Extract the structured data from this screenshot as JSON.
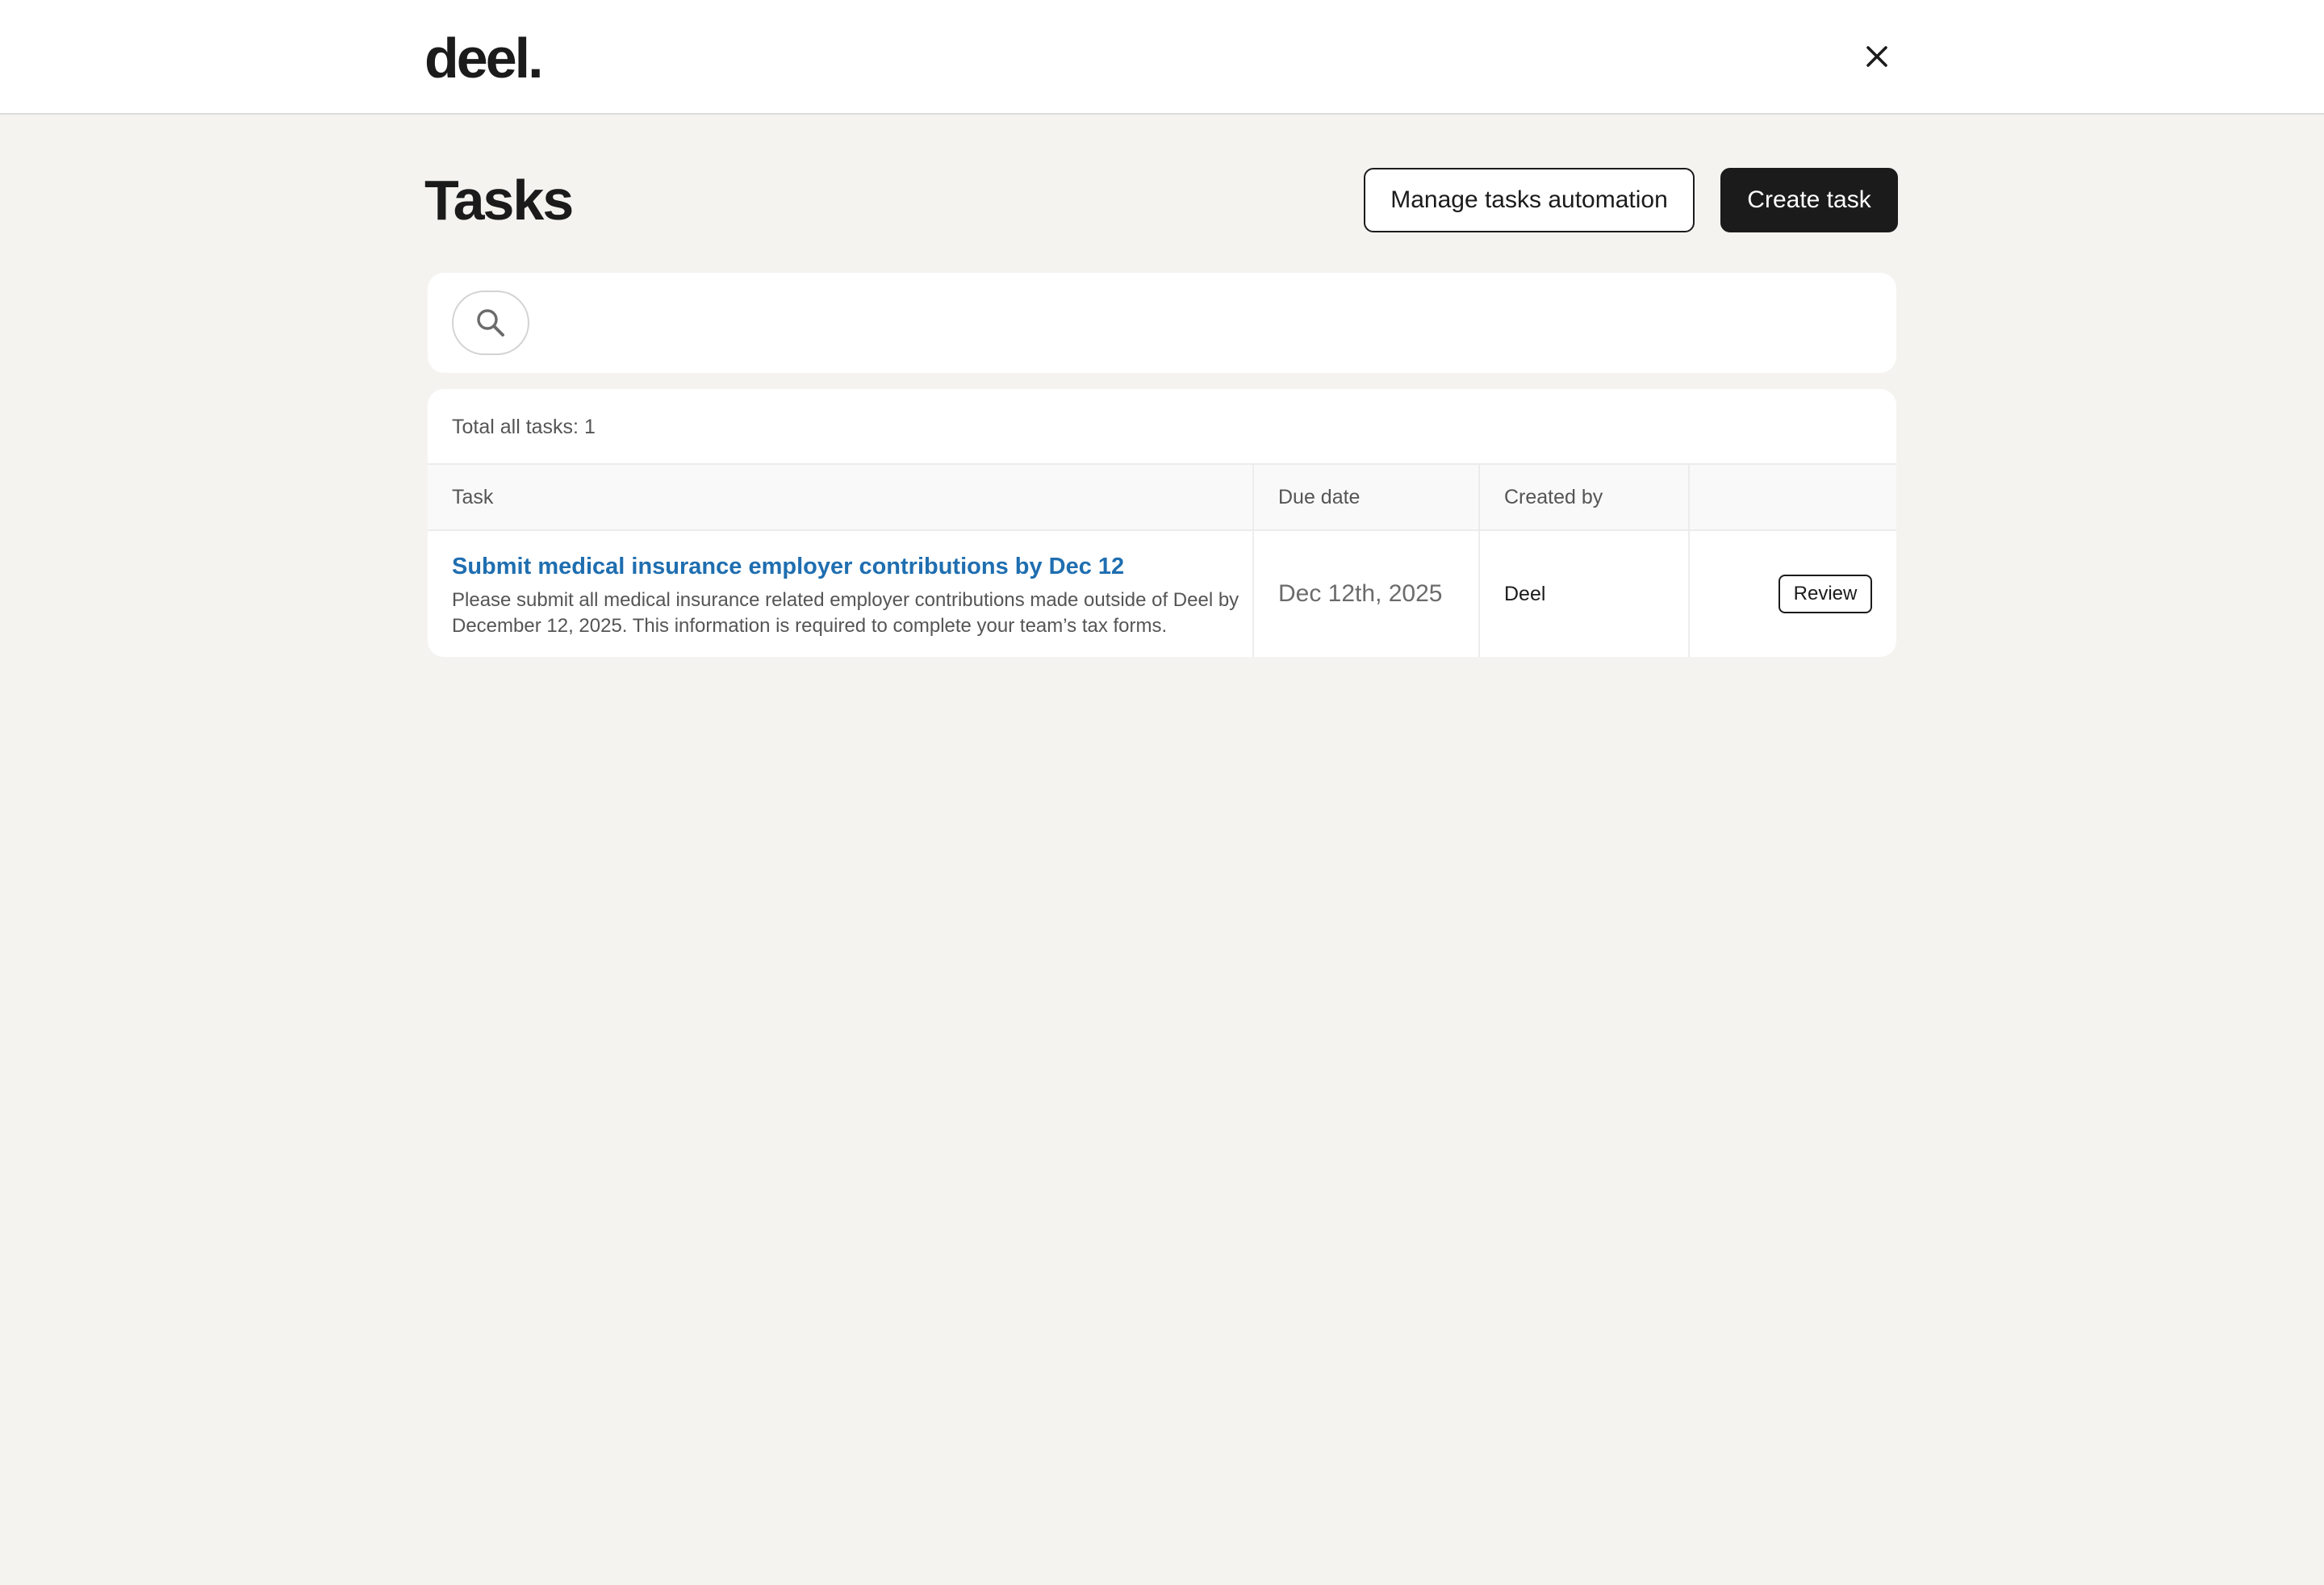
{
  "header": {
    "logo_text": "deel.",
    "close_icon": "close-icon"
  },
  "page": {
    "title": "Tasks",
    "manage_automation_label": "Manage tasks automation",
    "create_task_label": "Create task"
  },
  "search": {
    "icon": "search-icon",
    "value": "",
    "placeholder": ""
  },
  "table": {
    "total_label": "Total all tasks: 1",
    "columns": [
      "Task",
      "Due date",
      "Created by",
      ""
    ],
    "rows": [
      {
        "title": "Submit medical insurance employer contributions by Dec 12",
        "description": "Please submit all medical insurance related employer contributions made outside of Deel by December 12, 2025. This information is required to complete your team’s tax forms.",
        "due_date": "Dec 12th, 2025",
        "created_by": "Deel",
        "action_label": "Review"
      }
    ]
  },
  "colors": {
    "background": "#f4f3f0",
    "surface": "#ffffff",
    "primary_dark": "#1b1b1b",
    "link_blue": "#1f6eb0",
    "muted_text": "#555555"
  }
}
